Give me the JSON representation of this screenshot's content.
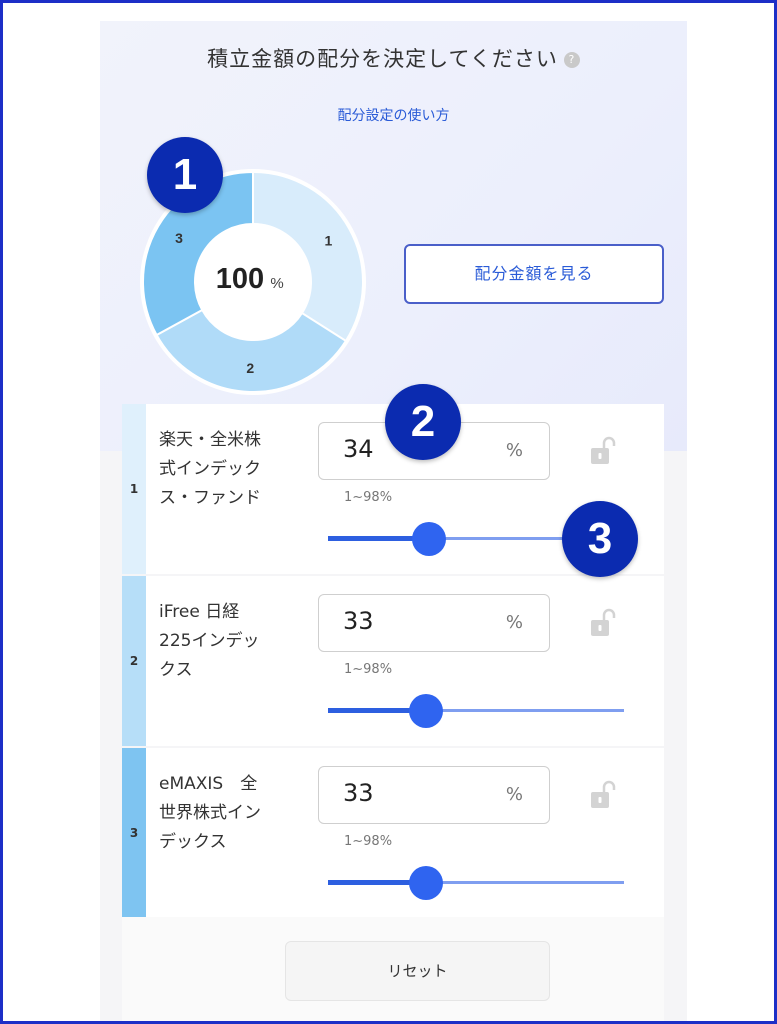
{
  "header": {
    "title": "積立金額の配分を決定してください",
    "help_glyph": "?",
    "howto_link": "配分設定の使い方"
  },
  "donut": {
    "center_value": "100",
    "center_unit": "%",
    "segments": [
      {
        "label": "1",
        "percent": 34,
        "color": "#d8ecfb"
      },
      {
        "label": "2",
        "percent": 33,
        "color": "#b0dbf8"
      },
      {
        "label": "3",
        "percent": 33,
        "color": "#7bc4f2"
      }
    ]
  },
  "view_amount_button": "配分金額を見る",
  "badges": [
    "1",
    "2",
    "3"
  ],
  "funds": [
    {
      "num": "1",
      "name_lines": [
        "楽天・全米株",
        "式インデック",
        "ス・ファンド"
      ],
      "value": "34",
      "unit": "%",
      "range": "1~98%",
      "slider_percent": 34,
      "color": "#dff0fc"
    },
    {
      "num": "2",
      "name_lines": [
        "iFree 日経",
        "225インデッ",
        "クス"
      ],
      "value": "33",
      "unit": "%",
      "range": "1~98%",
      "slider_percent": 33,
      "color": "#b6def8"
    },
    {
      "num": "3",
      "name_lines": [
        "eMAXIS　全",
        "世界株式イン",
        "デックス"
      ],
      "value": "33",
      "unit": "%",
      "range": "1~98%",
      "slider_percent": 33,
      "color": "#7ec4f1"
    }
  ],
  "reset_button": "リセット",
  "colors": {
    "accent": "#2d5fe0",
    "badge": "#0b2bb0",
    "link": "#2a5bd7",
    "frame": "#1d2fc7"
  },
  "icons": {
    "lock": "unlock-icon",
    "help": "help-circle-icon"
  }
}
